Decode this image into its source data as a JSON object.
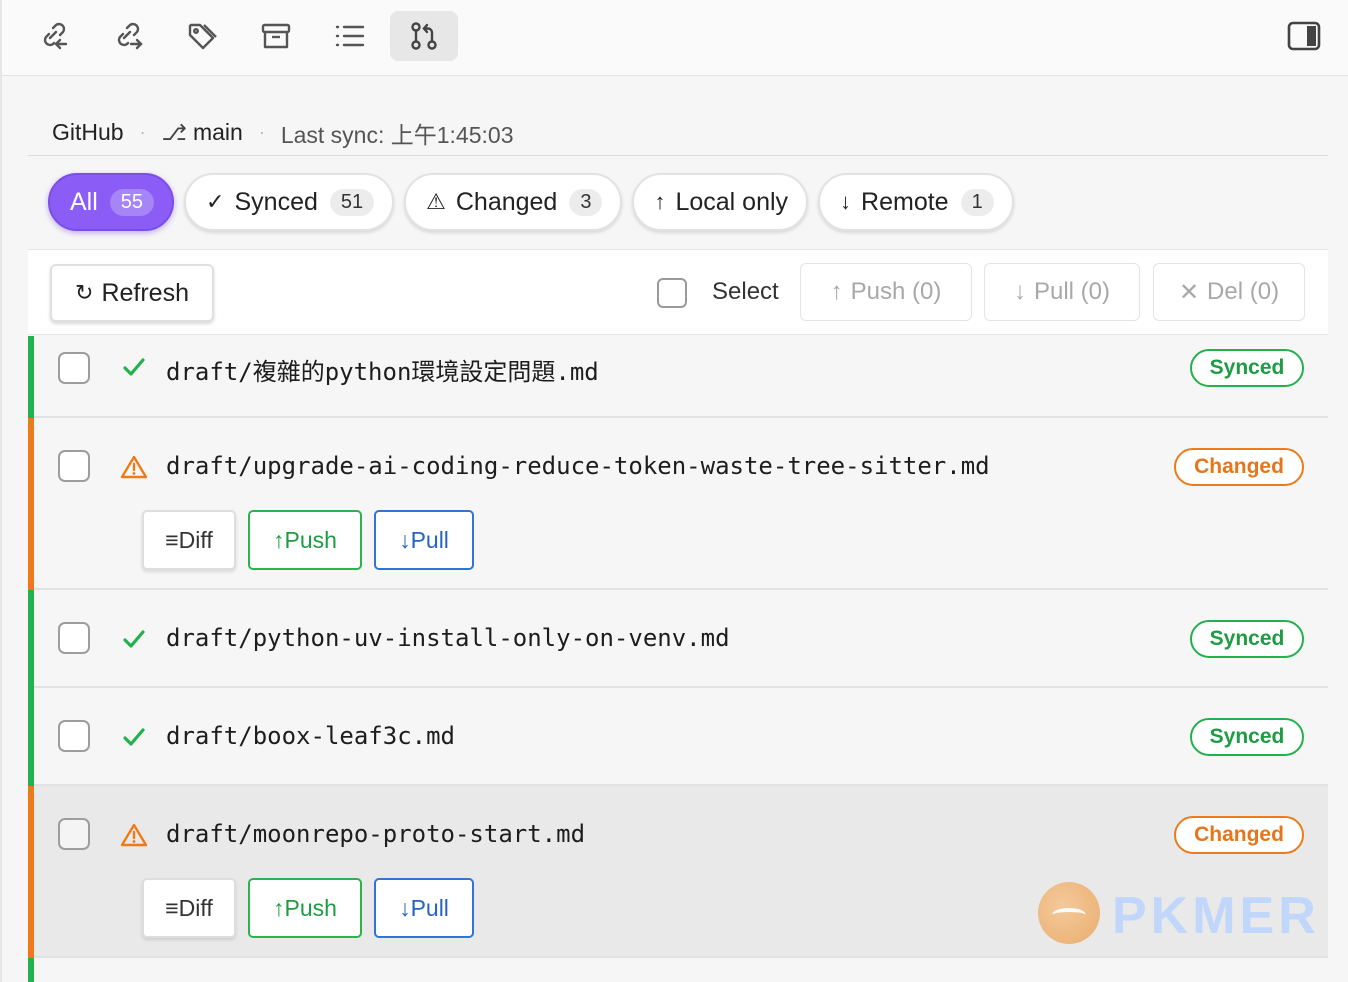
{
  "toolbar": {
    "buttons": [
      {
        "icon": "link-incoming-icon"
      },
      {
        "icon": "link-outgoing-icon"
      },
      {
        "icon": "tag-icon"
      },
      {
        "icon": "archive-icon"
      },
      {
        "icon": "list-icon"
      },
      {
        "icon": "git-pull-request-icon",
        "active": true
      }
    ],
    "right_icon": "sidebar-toggle-icon"
  },
  "meta": {
    "provider": "GitHub",
    "branch_icon": "⎇",
    "branch": "main",
    "last_sync": "Last sync: 上午1:45:03"
  },
  "filters": [
    {
      "label": "All",
      "count": "55",
      "icon": "",
      "active": true
    },
    {
      "label": "Synced",
      "count": "51",
      "icon": "✓"
    },
    {
      "label": "Changed",
      "count": "3",
      "icon": "⚠"
    },
    {
      "label": "Local only",
      "count": "",
      "icon": "↑"
    },
    {
      "label": "Remote",
      "count": "1",
      "icon": "↓"
    }
  ],
  "actions": {
    "refresh": "Refresh",
    "refresh_icon": "↻",
    "select": "Select",
    "push": "Push (0)",
    "pull": "Pull (0)",
    "del": "Del (0)"
  },
  "files": [
    {
      "name": "draft/複雜的python環境設定問題.md",
      "status": "Synced"
    },
    {
      "name": "draft/upgrade-ai-coding-reduce-token-waste-tree-sitter.md",
      "status": "Changed"
    },
    {
      "name": "draft/python-uv-install-only-on-venv.md",
      "status": "Synced"
    },
    {
      "name": "draft/boox-leaf3c.md",
      "status": "Synced"
    },
    {
      "name": "draft/moonrepo-proto-start.md",
      "status": "Changed"
    }
  ],
  "row_actions": {
    "diff": "≡Diff",
    "push": "↑Push",
    "pull": "↓Pull"
  },
  "colors": {
    "accent": "#8b5cf6",
    "synced": "#22b14c",
    "changed": "#ee7b1a",
    "pull": "#2f74d6"
  },
  "watermark": "PKMER"
}
